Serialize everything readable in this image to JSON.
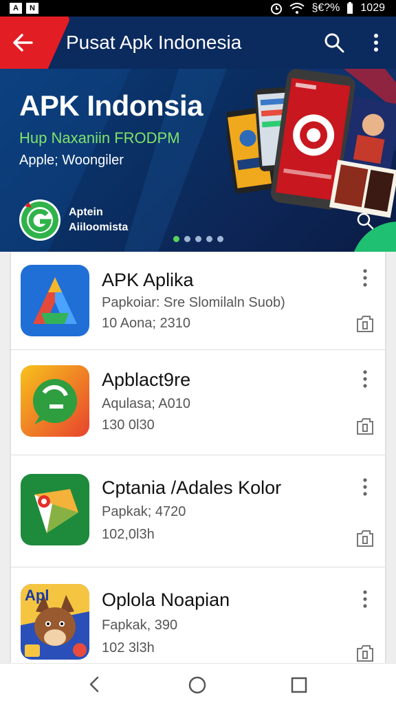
{
  "status_bar": {
    "left_icons": [
      "A",
      "N"
    ],
    "right_icons": [
      "alarm-icon",
      "wifi-icon",
      "signal-icon",
      "battery-icon"
    ],
    "signal_text": "§€?%",
    "time": "1029"
  },
  "app_bar": {
    "title": "Pusat Apk Indonesia",
    "background": "#0b2a5e",
    "accent": "#e31d24"
  },
  "banner": {
    "title": "APK Indonsia",
    "subtitle": "Hup Naxaniin FRODPM",
    "caption": "Apple; Woongiler",
    "brand_line1": "Aptein",
    "brand_line2": "Aiiloomista",
    "dots_total": 5,
    "dots_active": 0
  },
  "apps": [
    {
      "name": "APK Aplika",
      "meta1": "Papkoiar: Sre Slomilaln Suob)",
      "meta2": "10 Aona; 2310",
      "icon": "arrow-a-icon"
    },
    {
      "name": "Apblact9re",
      "meta1": "Aqulasa; A010",
      "meta2": "130 0l30",
      "icon": "chat-bubble-icon"
    },
    {
      "name": "Cptania /Adales Kolor",
      "meta1": "Papkak; 4720",
      "meta2": "102,0l3h",
      "icon": "map-pin-icon"
    },
    {
      "name": "Oplola Noapian",
      "meta1": "Fapkak, 390",
      "meta2": "102 3l3h",
      "icon": "fox-game-icon",
      "icon_text": "Apl"
    }
  ],
  "nav_bar": {
    "buttons": [
      "back-icon",
      "home-icon",
      "recents-icon"
    ]
  }
}
